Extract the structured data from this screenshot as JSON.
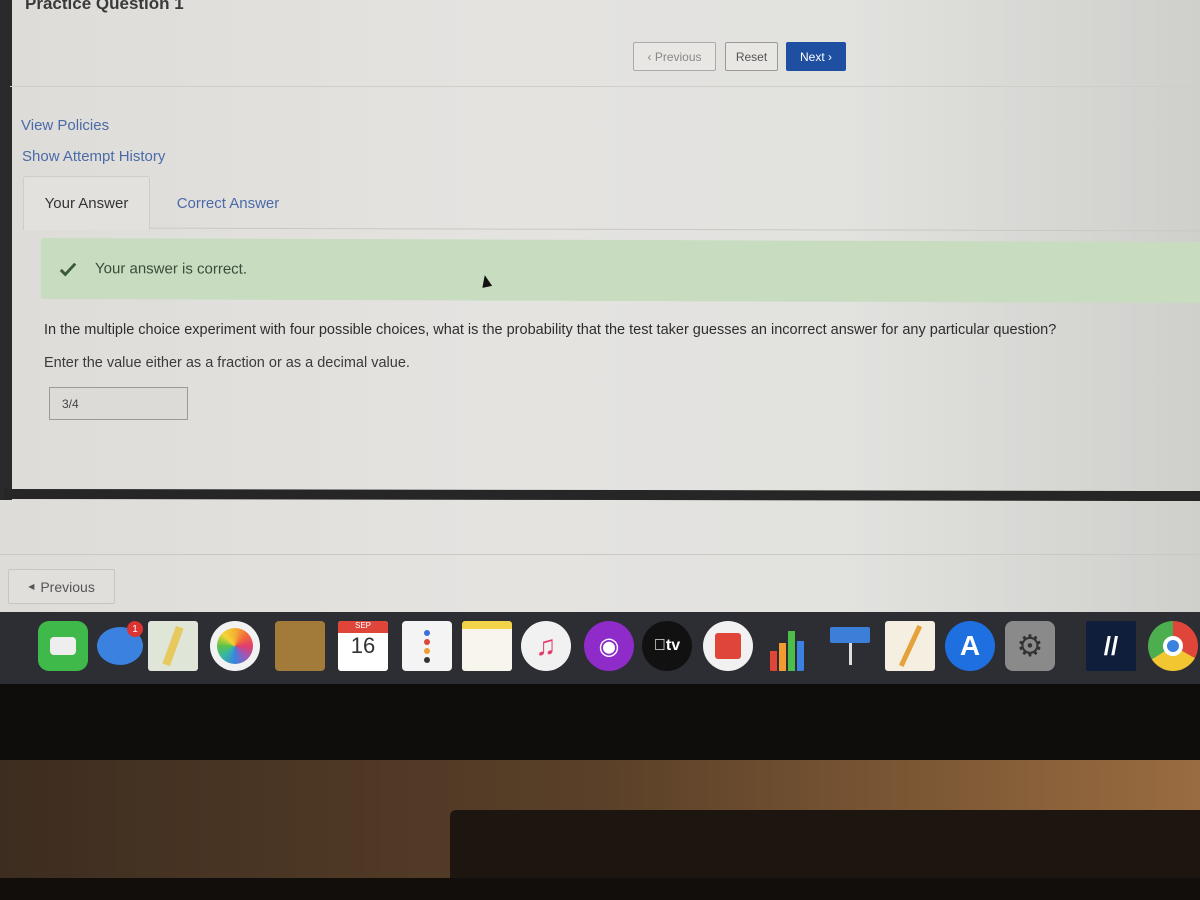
{
  "page": {
    "title": "Practice Question 1"
  },
  "toolbar": {
    "previous_label": "Previous",
    "reset_label": "Reset",
    "next_label": "Next"
  },
  "links": {
    "view_policies": "View Policies",
    "show_attempt_history": "Show Attempt History"
  },
  "tabs": [
    {
      "label": "Your Answer",
      "active": true
    },
    {
      "label": "Correct Answer",
      "active": false
    }
  ],
  "feedback": {
    "status": "correct",
    "message": "Your answer is correct.",
    "color": "#c8dcc0"
  },
  "question": {
    "text": "In the multiple choice experiment with four possible choices, what is the probability that the test taker guesses an incorrect answer for any particular question?",
    "instructions": "Enter the value either as a fraction or as a decimal value.",
    "answer_value": "3/4"
  },
  "footer": {
    "previous_label": "Previous"
  },
  "dock": {
    "items": [
      {
        "name": "FaceTime",
        "icon": "facetime-icon"
      },
      {
        "name": "Messages",
        "icon": "messages-icon",
        "badge": "1"
      },
      {
        "name": "Maps",
        "icon": "maps-icon"
      },
      {
        "name": "Photos",
        "icon": "photos-icon"
      },
      {
        "name": "Contacts",
        "icon": "contacts-icon"
      },
      {
        "name": "Calendar",
        "icon": "calendar-icon",
        "month": "SEP",
        "day": "16"
      },
      {
        "name": "Reminders",
        "icon": "reminders-icon"
      },
      {
        "name": "Notes",
        "icon": "notes-icon"
      },
      {
        "name": "Music",
        "icon": "music-icon"
      },
      {
        "name": "Podcasts",
        "icon": "podcasts-icon"
      },
      {
        "name": "TV",
        "icon": "tv-icon",
        "label": "tv"
      },
      {
        "name": "News",
        "icon": "news-icon"
      },
      {
        "name": "Numbers",
        "icon": "numbers-icon"
      },
      {
        "name": "Keynote",
        "icon": "keynote-icon"
      },
      {
        "name": "Pages",
        "icon": "pages-icon"
      },
      {
        "name": "App Store",
        "icon": "app-store-icon"
      },
      {
        "name": "System Preferences",
        "icon": "system-preferences-icon"
      },
      {
        "name": "WebAssign",
        "icon": "webassign-icon"
      },
      {
        "name": "Chrome",
        "icon": "chrome-icon"
      }
    ]
  }
}
